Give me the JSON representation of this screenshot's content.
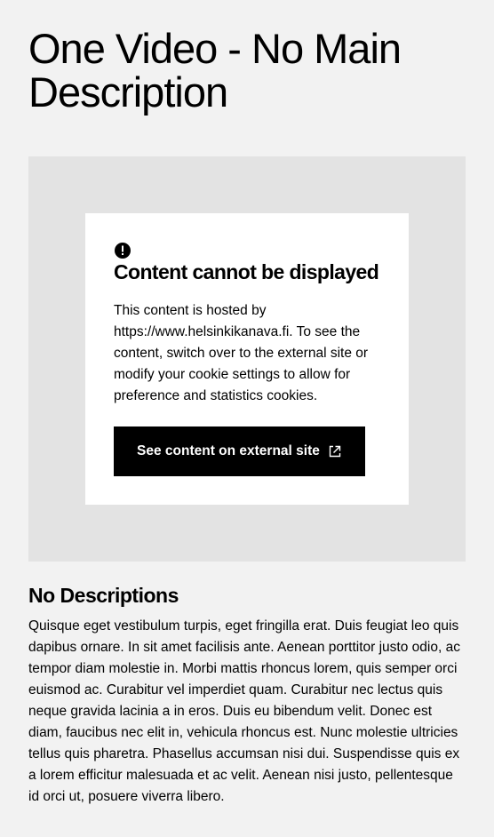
{
  "page": {
    "title": "One Video - No Main Description"
  },
  "embed_notice": {
    "icon": "alert-circle-icon",
    "title": "Content cannot be displayed",
    "text": "This content is hosted by https://www.helsinkikanava.fi. To see the content, switch over to the external site or modify your cookie settings to allow for preference and statistics cookies.",
    "button_label": "See content on external site",
    "button_icon": "link-external-icon"
  },
  "section": {
    "heading": "No Descriptions",
    "body": "Quisque eget vestibulum turpis, eget fringilla erat. Duis feugiat leo quis dapibus ornare. In sit amet facilisis ante. Aenean porttitor justo odio, ac tempor diam molestie in. Morbi mattis rhoncus lorem, quis semper orci euismod ac. Curabitur vel imperdiet quam. Curabitur nec lectus quis neque gravida lacinia a in eros. Duis eu bibendum velit. Donec est diam, faucibus nec elit in, vehicula rhoncus est. Nunc molestie ultricies tellus quis pharetra. Phasellus accumsan nisi dui. Suspendisse quis ex a lorem efficitur malesuada et ac velit. Aenean nisi justo, pellentesque id orci ut, posuere viverra libero."
  },
  "colors": {
    "page_background": "#f2f2f2",
    "embed_background": "#e3e3e3",
    "card_background": "#ffffff",
    "button_background": "#000000",
    "button_text": "#ffffff"
  }
}
